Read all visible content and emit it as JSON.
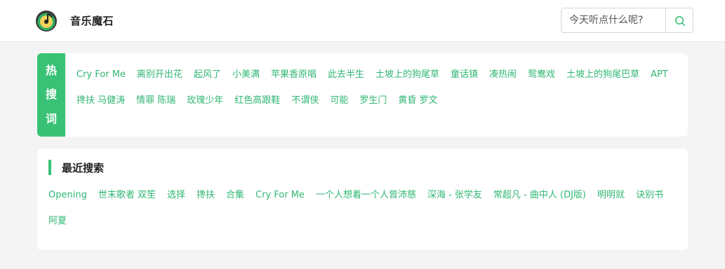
{
  "app": {
    "title": "音乐魔石"
  },
  "search": {
    "placeholder": "今天听点什么呢?"
  },
  "hot": {
    "label_chars": [
      "热",
      "搜",
      "词"
    ],
    "items": [
      "Cry For Me",
      "离别开出花",
      "起风了",
      "小美满",
      "苹果香原唱",
      "此去半生",
      "土坡上的狗尾草",
      "童话镇",
      "凑热闹",
      "鸳鸯戏",
      "土坡上的狗尾巴草",
      "APT",
      "搀扶 马健涛",
      "情罪 陈瑞",
      "玫瑰少年",
      "红色高跟鞋",
      "不谓侠",
      "可能",
      "罗生门",
      "黄昏 罗文"
    ]
  },
  "recent": {
    "title": "最近搜索",
    "items": [
      "Opening",
      "世末歌者 双笙",
      "选择",
      "搀扶",
      "合集",
      "Cry For Me",
      "一个人想着一个人曾沛慈",
      "深海 - 张学友",
      "常超凡 - 曲中人 (DJ版)",
      "明明就",
      "诀别书",
      "阿夏"
    ]
  },
  "colors": {
    "accent": "#39c276",
    "tag": "#31b774"
  }
}
